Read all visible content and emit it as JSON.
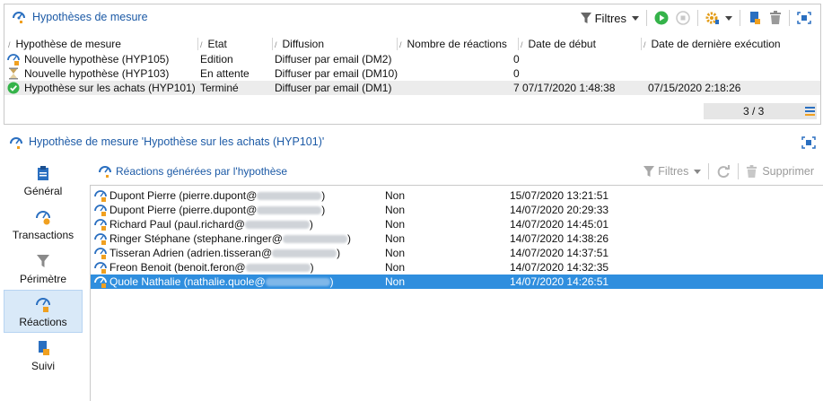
{
  "top_panel": {
    "title": "Hypothèses de mesure",
    "toolbar": {
      "filters_label": "Filtres"
    },
    "columns": [
      "Hypothèse de mesure",
      "Etat",
      "Diffusion",
      "Nombre de réactions",
      "Date de début",
      "Date de dernière exécution"
    ],
    "rows": [
      {
        "name": "Nouvelle hypothèse (HYP105)",
        "state": "Edition",
        "diffusion": "Diffuser par email (DM2)",
        "reactions": "0",
        "start": "",
        "last_exec": "",
        "icon": "hypothesis-edit-icon"
      },
      {
        "name": "Nouvelle hypothèse (HYP103)",
        "state": "En attente",
        "diffusion": "Diffuser par email (DM10)",
        "reactions": "0",
        "start": "",
        "last_exec": "",
        "icon": "hourglass-icon"
      },
      {
        "name": "Hypothèse sur les achats (HYP101)",
        "state": "Terminé",
        "diffusion": "Diffuser par email (DM1)",
        "reactions": "7",
        "start": "07/17/2020 1:48:38",
        "last_exec": "07/15/2020 2:18:26",
        "icon": "check-circle-icon"
      }
    ],
    "count": "3 / 3"
  },
  "bottom_panel": {
    "title": "Hypothèse de mesure 'Hypothèse sur les achats (HYP101)'"
  },
  "sidenav": {
    "items": [
      {
        "label": "Général",
        "icon": "clipboard-icon"
      },
      {
        "label": "Transactions",
        "icon": "transactions-icon"
      },
      {
        "label": "Périmètre",
        "icon": "funnel-icon"
      },
      {
        "label": "Réactions",
        "icon": "reactions-icon"
      },
      {
        "label": "Suivi",
        "icon": "tracking-icon"
      }
    ]
  },
  "reactions": {
    "title": "Réactions générées par l'hypothèse",
    "filters_label": "Filtres",
    "delete_label": "Supprimer",
    "rows": [
      {
        "name_prefix": "Dupont Pierre (pierre.dupont@",
        "suffix": ")",
        "value": "Non",
        "date": "15/07/2020 13:21:51"
      },
      {
        "name_prefix": "Dupont Pierre (pierre.dupont@",
        "suffix": ")",
        "value": "Non",
        "date": "14/07/2020 20:29:33"
      },
      {
        "name_prefix": "Richard Paul (paul.richard@",
        "suffix": ")",
        "value": "Non",
        "date": "14/07/2020 14:45:01"
      },
      {
        "name_prefix": "Ringer Stéphane (stephane.ringer@",
        "suffix": ")",
        "value": "Non",
        "date": "14/07/2020 14:38:26"
      },
      {
        "name_prefix": "Tisseran Adrien (adrien.tisseran@",
        "suffix": ")",
        "value": "Non",
        "date": "14/07/2020 14:37:51"
      },
      {
        "name_prefix": "Freon Benoit (benoit.feron@",
        "suffix": ")",
        "value": "Non",
        "date": "14/07/2020 14:32:35"
      },
      {
        "name_prefix": "Quole Nathalie (nathalie.quole@",
        "suffix": ")",
        "value": "Non",
        "date": "14/07/2020 14:26:51"
      }
    ],
    "selected_index": 6
  },
  "colors": {
    "title_blue": "#1c5aa6",
    "selection_blue": "#2f8ede",
    "play_green": "#35b34a",
    "icon_blue": "#2a6fc0",
    "icon_orange": "#f0a020"
  }
}
